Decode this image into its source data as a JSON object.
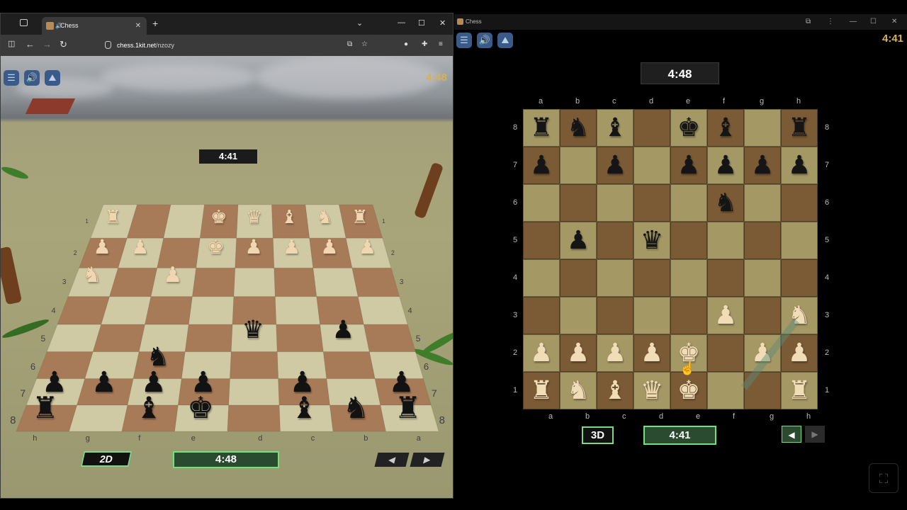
{
  "browser": {
    "tab_title": "Chess",
    "url_host": "chess.1kit.net",
    "url_path": "/nzozy",
    "new_tab_symbol": "+",
    "tab_close_symbol": "✕"
  },
  "app_window": {
    "title": "Chess"
  },
  "left_game": {
    "top_timer": "4:48",
    "opponent_timer": "4:41",
    "player_timer": "4:48",
    "mode_button": "2D",
    "prev_label": "◀",
    "next_label": "▶",
    "files": [
      "h",
      "g",
      "f",
      "e",
      "d",
      "c",
      "b",
      "a"
    ],
    "ranks_left": [
      "1",
      "2",
      "3",
      "4",
      "5",
      "6",
      "7",
      "8"
    ],
    "ranks_right": [
      "1",
      "2",
      "3",
      "4",
      "5",
      "6",
      "7",
      "8"
    ]
  },
  "right_game": {
    "opponent_timer": "4:48",
    "player_timer": "4:41",
    "corner_timer": "4:41",
    "mode_button": "3D",
    "prev_label": "◀",
    "next_label": "▶",
    "files": [
      "a",
      "b",
      "c",
      "d",
      "e",
      "f",
      "g",
      "h"
    ],
    "ranks": [
      "8",
      "7",
      "6",
      "5",
      "4",
      "3",
      "2",
      "1"
    ]
  },
  "position": {
    "a8": "bR",
    "b8": "bN",
    "c8": "bB",
    "e8": "bK",
    "f8": "bB",
    "h8": "bR",
    "a7": "bP",
    "c7": "bP",
    "e7": "bP",
    "f7": "bP",
    "g7": "bP",
    "h7": "bP",
    "f6": "bN",
    "b5": "bP",
    "d5": "bQ",
    "f3": "wP",
    "h3": "wN",
    "a2": "wP",
    "b2": "wP",
    "c2": "wP",
    "d2": "wP",
    "e2": "wK",
    "g2": "wP",
    "h2": "wP",
    "a1": "wR",
    "b1": "wN",
    "c1": "wB",
    "d1": "wQ",
    "e1": "wK",
    "h1": "wR"
  },
  "colors": {
    "light_square": "#a49865",
    "dark_square": "#7a5b35",
    "accent_green": "#6fe27c",
    "timer_gold": "#d4b25a",
    "toolbar_blue": "#3a5b8a"
  },
  "icons": {
    "menu": "hamburger-icon",
    "sound": "speaker-icon",
    "background": "landscape-icon",
    "fullscreen": "fullscreen-icon"
  }
}
